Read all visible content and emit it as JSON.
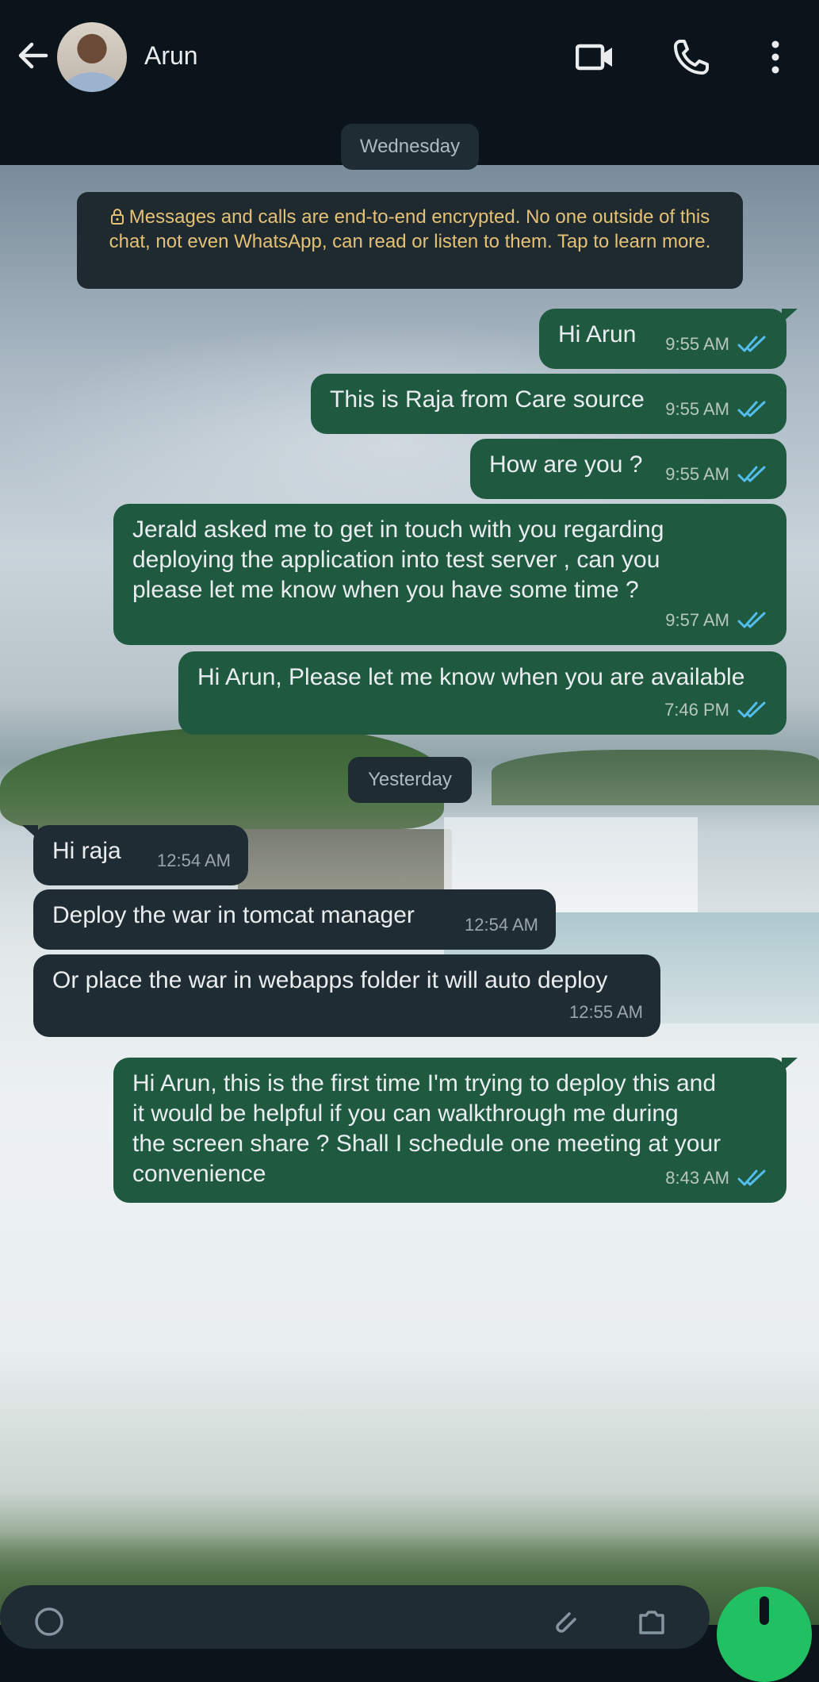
{
  "header": {
    "contact_name": "Arun",
    "icons": [
      "back-arrow-icon",
      "video-call-icon",
      "voice-call-icon",
      "more-options-icon"
    ]
  },
  "date_labels": {
    "first": "Wednesday",
    "second": "Yesterday"
  },
  "encryption_notice": "Messages and calls are end-to-end encrypted. No one outside of this chat, not even WhatsApp, can read or listen to them. Tap to learn more.",
  "messages": [
    {
      "direction": "out",
      "text": "Hi Arun",
      "time": "9:55 AM",
      "status": "read"
    },
    {
      "direction": "out",
      "text": "This is Raja from Care source",
      "time": "9:55 AM",
      "status": "read"
    },
    {
      "direction": "out",
      "text": "How are you ?",
      "time": "9:55 AM",
      "status": "read"
    },
    {
      "direction": "out",
      "text": "Jerald asked me to get in touch with you regarding\ndeploying the application into test server , can you\nplease let me know when you have some time ?",
      "time": "9:57 AM",
      "status": "read"
    },
    {
      "direction": "out",
      "text": "Hi Arun, Please let me know when you are available",
      "time": "7:46 PM",
      "status": "read"
    },
    {
      "direction": "in",
      "text": "Hi raja",
      "time": "12:54 AM"
    },
    {
      "direction": "in",
      "text": "Deploy the war in tomcat manager",
      "time": "12:54 AM"
    },
    {
      "direction": "in",
      "text": "Or place the war in webapps folder it will auto deploy",
      "time": "12:55 AM"
    },
    {
      "direction": "out",
      "text": "Hi Arun, this is the first time I'm trying to deploy this and\nit would be helpful if you can walkthrough me during\nthe screen share ? Shall I schedule one meeting at your\nconvenience",
      "time": "8:43 AM",
      "status": "read"
    }
  ],
  "colors": {
    "outgoing_bubble": "#1f5a40",
    "incoming_bubble": "#202c33",
    "read_tick": "#53bdeb",
    "notice_text": "#e4c175",
    "mic_button": "#21c063"
  }
}
